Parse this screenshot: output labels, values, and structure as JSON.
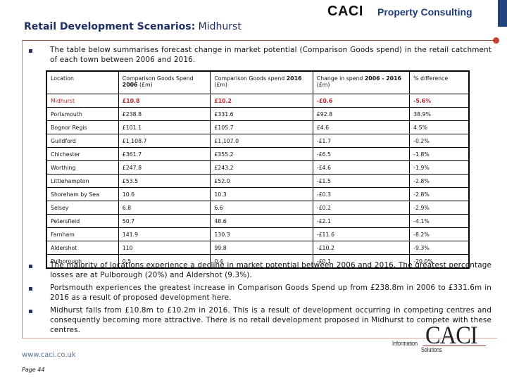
{
  "header": {
    "brand": "CACI",
    "division": "Property Consulting",
    "title_bold": "Retail Development Scenarios:",
    "title_rest": " Midhurst"
  },
  "intro": {
    "bullet": "▪",
    "text": "The table below summarises forecast change in market potential (Comparison Goods spend) in the retail catchment of each town between 2006 and 2016."
  },
  "table": {
    "headers": [
      {
        "text": "Location",
        "bold": ""
      },
      {
        "text": "Comparison Goods Spend ",
        "bold": "2006",
        "suffix": " (£m)"
      },
      {
        "text": "Comparison Goods spend ",
        "bold": "2016",
        "suffix": " (£m)"
      },
      {
        "text": "Change in spend ",
        "bold": "2006 - 2016",
        "suffix": " (£m)"
      },
      {
        "text": "% difference",
        "bold": ""
      }
    ],
    "highlight_color": "#b3262a",
    "rows": [
      {
        "location": "Midhurst",
        "spend_2006": "£10.8",
        "spend_2016": "£10.2",
        "change": "-£0.6",
        "pct": "-5.6%",
        "highlight": true
      },
      {
        "location": "Portsmouth",
        "spend_2006": "£238.8",
        "spend_2016": "£331.6",
        "change": "£92.8",
        "pct": "38.9%"
      },
      {
        "location": "Bognor Regis",
        "spend_2006": "£101.1",
        "spend_2016": "£105.7",
        "change": "£4.6",
        "pct": "4.5%"
      },
      {
        "location": "Guildford",
        "spend_2006": "£1,108.7",
        "spend_2016": "£1,107.0",
        "change": "-£1.7",
        "pct": "-0.2%"
      },
      {
        "location": "Chichester",
        "spend_2006": "£361.7",
        "spend_2016": "£355.2",
        "change": "-£6.5",
        "pct": "-1.8%"
      },
      {
        "location": "Worthing",
        "spend_2006": "£247.8",
        "spend_2016": "£243.2",
        "change": "-£4.6",
        "pct": "-1.9%"
      },
      {
        "location": "Littlehampton",
        "spend_2006": "£53.5",
        "spend_2016": "£52.0",
        "change": "-£1.5",
        "pct": "-2.8%"
      },
      {
        "location": "Shoreham by Sea",
        "spend_2006": "10.6",
        "spend_2016": "10.3",
        "change": "-£0.3",
        "pct": "-2.8%"
      },
      {
        "location": "Selsey",
        "spend_2006": "6.8",
        "spend_2016": "6.6",
        "change": "-£0.2",
        "pct": "-2.9%"
      },
      {
        "location": "Petersfield",
        "spend_2006": "50.7",
        "spend_2016": "48.6",
        "change": "-£2.1",
        "pct": "-4.1%"
      },
      {
        "location": "Farnham",
        "spend_2006": "141.9",
        "spend_2016": "130.3",
        "change": "-£11.6",
        "pct": "-8.2%"
      },
      {
        "location": "Aldershot",
        "spend_2006": "110",
        "spend_2016": "99.8",
        "change": "-£10.2",
        "pct": "-9.3%"
      },
      {
        "location": "Pulborough",
        "spend_2006": "0.5",
        "spend_2016": "0.4",
        "change": "-£0.1",
        "pct": "-20.0%"
      }
    ]
  },
  "findings": [
    {
      "bullet": "▪",
      "text": "The majority of locations experience a decline in market potential between 2006 and 2016.  The greatest percentage losses are at Pulborough (20%) and Aldershot (9.3%)."
    },
    {
      "bullet": "▪",
      "text": "Portsmouth experiences the greatest increase in Comparison Goods Spend up from £238.8m in 2006 to £331.6m in 2016 as a result of proposed development here."
    },
    {
      "bullet": "▪",
      "text": "Midhurst falls from £10.8m to £10.2m in 2016.  This is a result of development occurring in competing centres and consequently becoming more attractive.  There is no retail development proposed in Midhurst to compete with these centres."
    }
  ],
  "footer": {
    "url": "www.caci.co.uk",
    "page": "Page 44",
    "logo_info": "Information",
    "logo_caci": "CACI",
    "logo_solutions": "Solutions"
  }
}
